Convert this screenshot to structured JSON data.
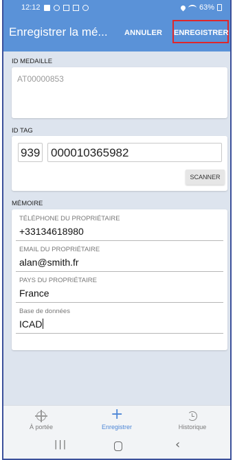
{
  "status_bar": {
    "time": "12:12",
    "battery": "63%",
    "icons": [
      "message-icon",
      "sync-icon",
      "sim-icon",
      "image-icon",
      "whatsapp-icon",
      "location-icon",
      "wifi-icon",
      "battery-icon"
    ]
  },
  "action_bar": {
    "title": "Enregistrer la mé...",
    "cancel_label": "ANNULER",
    "save_label": "ENREGISTRER",
    "background": "#5a92d8",
    "highlight_color": "#e0262a"
  },
  "medal": {
    "section_label": "ID MEDAILLE",
    "value": "AT00000853"
  },
  "tag": {
    "section_label": "ID TAG",
    "code": "939",
    "number": "000010365982",
    "scan_label": "SCANNER"
  },
  "memory": {
    "section_label": "MÉMOIRE",
    "fields": [
      {
        "label": "TÉLÉPHONE DU PROPRIÉTAIRE",
        "value": "+33134618980"
      },
      {
        "label": "EMAIL DU PROPRIÉTAIRE",
        "value": "alan@smith.fr"
      },
      {
        "label": "PAYS DU PROPRIÉTAIRE",
        "value": "France"
      },
      {
        "label": "Base de données",
        "value": "ICAD"
      }
    ]
  },
  "tabs": [
    {
      "label": "À portée",
      "icon": "target-icon",
      "active": false
    },
    {
      "label": "Enregistrer",
      "icon": "plus-icon",
      "active": true
    },
    {
      "label": "Historique",
      "icon": "history-icon",
      "active": false
    }
  ],
  "nav_bar": {
    "buttons": [
      "recent-apps-icon",
      "home-icon",
      "back-icon"
    ]
  },
  "accent": "#4d86d6"
}
